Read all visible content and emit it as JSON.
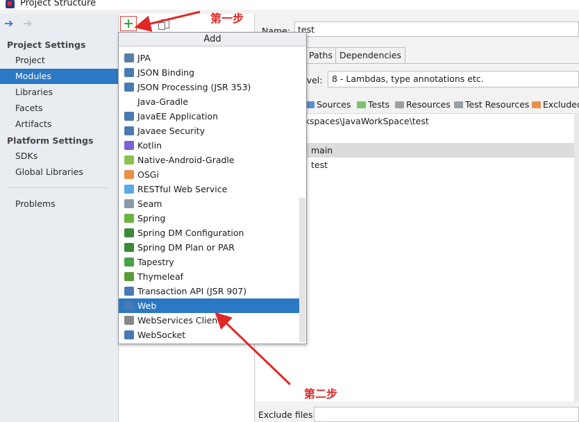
{
  "window": {
    "title": "Project Structure"
  },
  "sidebar": {
    "project_settings_header": "Project Settings",
    "project_items": [
      "Project",
      "Modules",
      "Libraries",
      "Facets",
      "Artifacts"
    ],
    "platform_settings_header": "Platform Settings",
    "platform_items": [
      "SDKs",
      "Global Libraries"
    ],
    "problems": "Problems",
    "selected": "Modules"
  },
  "popup": {
    "title": "Add",
    "items": [
      {
        "label": "JPA",
        "icon": "jpa-icon",
        "color": "#5a7fa8"
      },
      {
        "label": "JSON Binding",
        "icon": "json-binding-icon",
        "color": "#4a7ab3"
      },
      {
        "label": "JSON Processing (JSR 353)",
        "icon": "json-processing-icon",
        "color": "#4a7ab3"
      },
      {
        "label": "Java-Gradle",
        "icon": "",
        "color": ""
      },
      {
        "label": "JavaEE Application",
        "icon": "javaee-application-icon",
        "color": "#4a7ab3"
      },
      {
        "label": "Javaee Security",
        "icon": "javaee-security-icon",
        "color": "#4a7ab3"
      },
      {
        "label": "Kotlin",
        "icon": "kotlin-icon",
        "color": "#7b5fd6"
      },
      {
        "label": "Native-Android-Gradle",
        "icon": "android-icon",
        "color": "#8cc152"
      },
      {
        "label": "OSGi",
        "icon": "osgi-icon",
        "color": "#e8904a"
      },
      {
        "label": "RESTful Web Service",
        "icon": "restful-icon",
        "color": "#5aa9e6"
      },
      {
        "label": "Seam",
        "icon": "seam-icon",
        "color": "#8a9aa8"
      },
      {
        "label": "Spring",
        "icon": "spring-icon",
        "color": "#6db33f"
      },
      {
        "label": "Spring DM Configuration",
        "icon": "spring-dm-configuration-icon",
        "color": "#3a8a3a"
      },
      {
        "label": "Spring DM Plan or PAR",
        "icon": "spring-dm-plan-icon",
        "color": "#3a8a3a"
      },
      {
        "label": "Tapestry",
        "icon": "tapestry-icon",
        "color": "#4aa04a"
      },
      {
        "label": "Thymeleaf",
        "icon": "thymeleaf-icon",
        "color": "#5a9a3a"
      },
      {
        "label": "Transaction API (JSR 907)",
        "icon": "transaction-api-icon",
        "color": "#4a7ab3"
      },
      {
        "label": "Web",
        "icon": "web-icon",
        "color": "#4a7ab3"
      },
      {
        "label": "WebServices Client",
        "icon": "webservices-client-icon",
        "color": "#888888"
      },
      {
        "label": "WebSocket",
        "icon": "websocket-icon",
        "color": "#4a7ab3"
      }
    ],
    "selected": "Web"
  },
  "content": {
    "name_label": "Name:",
    "name_value": "test",
    "tabs": [
      "Paths",
      "Dependencies"
    ],
    "level_label": "evel:",
    "level_value": "8 - Lambdas, type annotations etc.",
    "source_toolbar": [
      {
        "label": "Sources",
        "icon": "sources-folder-icon"
      },
      {
        "label": "Tests",
        "icon": "tests-folder-icon"
      },
      {
        "label": "Resources",
        "icon": "resources-folder-icon"
      },
      {
        "label": "Test Resources",
        "icon": "test-resources-folder-icon"
      },
      {
        "label": "Excluded",
        "icon": "excluded-folder-icon"
      }
    ],
    "tree": [
      "orkspaces\\JavaWorkSpace\\test",
      "c",
      "main",
      "test"
    ],
    "exclude_label": "Exclude files:"
  },
  "annotations": {
    "step1": "第一步",
    "step2": "第二步",
    "color": "#e02828"
  }
}
